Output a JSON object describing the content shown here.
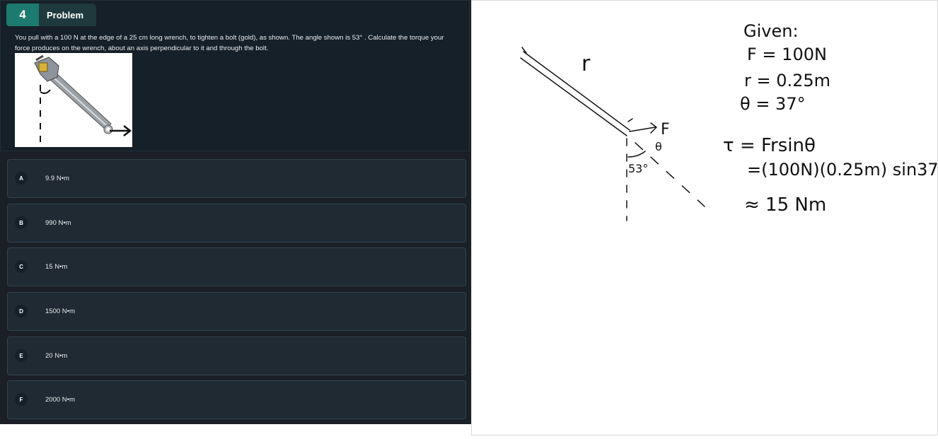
{
  "problem": {
    "number": "4",
    "tab_label": "Problem",
    "question": "You pull with a 100 N at the edge of a 25 cm long wrench, to tighten a bolt (gold), as shown. The angle shown is 53° . Calculate the torque your force produces on the wrench, about an axis perpendicular to it and through the bolt."
  },
  "choices": [
    {
      "letter": "A",
      "answer": "9.9 N•m"
    },
    {
      "letter": "B",
      "answer": "990 N•m"
    },
    {
      "letter": "C",
      "answer": "15 N•m"
    },
    {
      "letter": "D",
      "answer": "1500 N•m"
    },
    {
      "letter": "E",
      "answer": "20 N•m"
    },
    {
      "letter": "F",
      "answer": "2000 N•m"
    }
  ],
  "notes": {
    "r_label": "r",
    "f_label": "F",
    "theta_label": "θ",
    "angle_label": "53°",
    "given_title": "Given:",
    "given_f": "F = 100N",
    "given_r": "r = 0.25m",
    "given_theta": "θ = 37°",
    "torque_eq": "τ = Frsinθ",
    "torque_sub": "=(100N)(0.25m) sin37",
    "torque_result": "≈ 15 Nm"
  },
  "colors": {
    "accent": "#1c7a6e",
    "panel": "#162028",
    "choice_bg": "#1f2a32"
  }
}
